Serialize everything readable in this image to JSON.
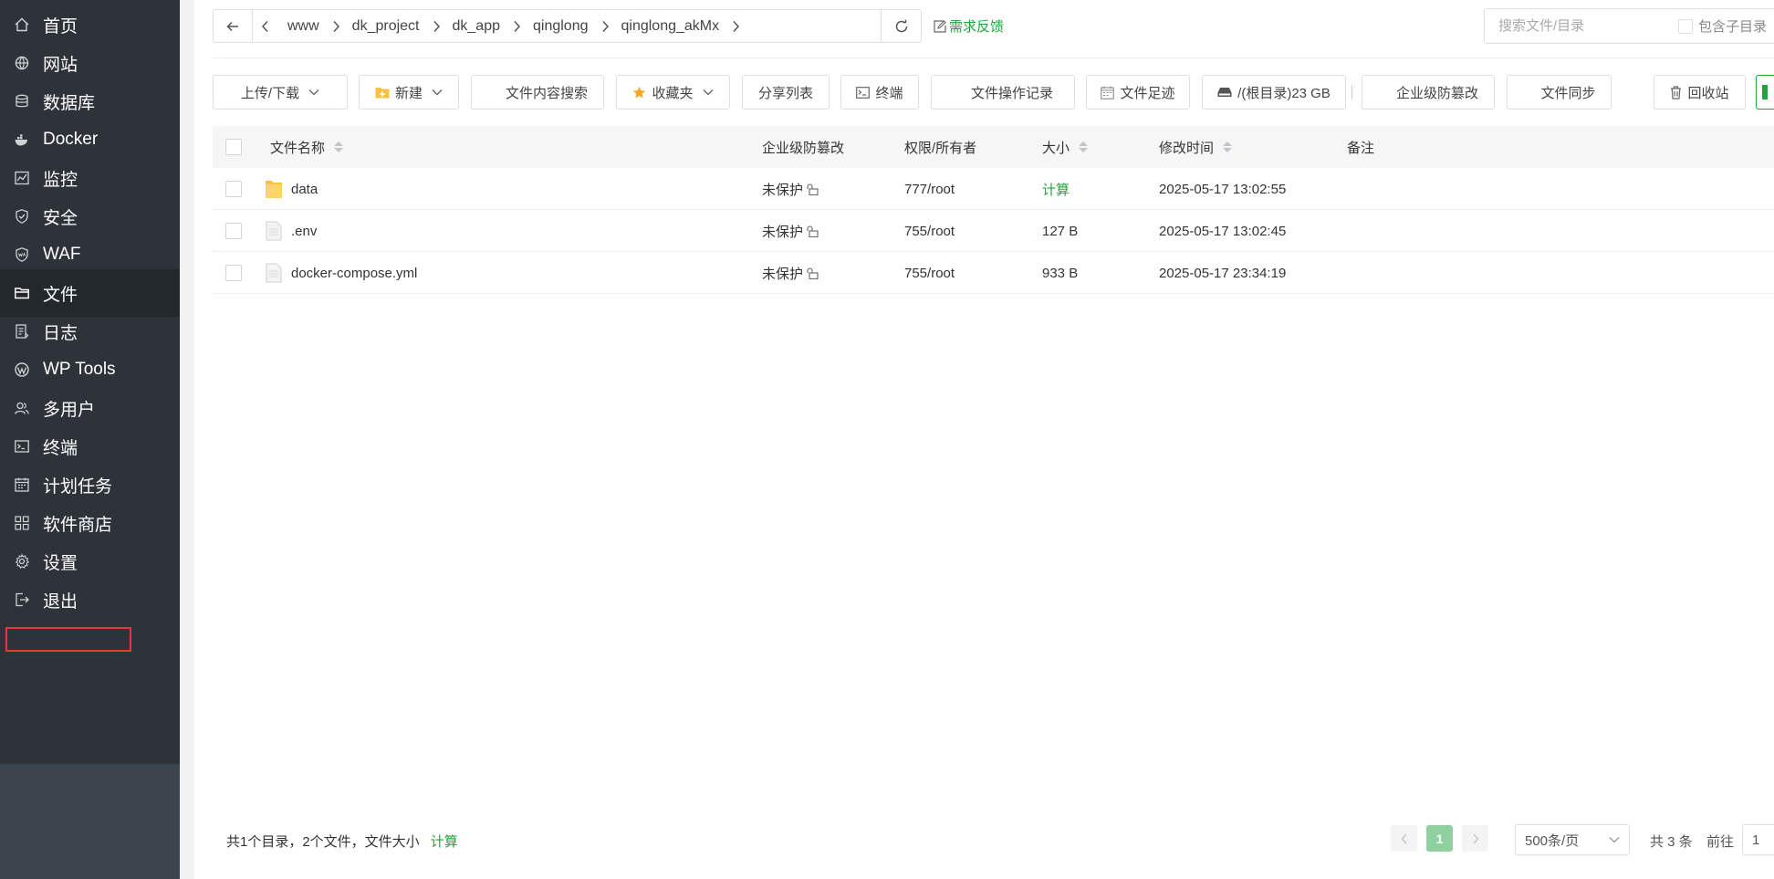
{
  "sidebar": {
    "items": [
      {
        "label": "首页",
        "icon": "home-icon"
      },
      {
        "label": "网站",
        "icon": "globe-icon"
      },
      {
        "label": "数据库",
        "icon": "database-icon"
      },
      {
        "label": "Docker",
        "icon": "docker-icon"
      },
      {
        "label": "监控",
        "icon": "monitor-icon"
      },
      {
        "label": "安全",
        "icon": "shield-icon"
      },
      {
        "label": "WAF",
        "icon": "waf-shield-icon"
      },
      {
        "label": "文件",
        "icon": "folder-icon",
        "active": true
      },
      {
        "label": "日志",
        "icon": "log-icon"
      },
      {
        "label": "WP Tools",
        "icon": "wordpress-icon"
      },
      {
        "label": "多用户",
        "icon": "users-icon"
      },
      {
        "label": "终端",
        "icon": "terminal-icon"
      },
      {
        "label": "计划任务",
        "icon": "calendar-icon"
      },
      {
        "label": "软件商店",
        "icon": "app-store-icon",
        "highlighted": true
      },
      {
        "label": "设置",
        "icon": "gear-icon"
      },
      {
        "label": "退出",
        "icon": "logout-icon"
      }
    ]
  },
  "path": {
    "segments": [
      "www",
      "dk_project",
      "dk_app",
      "qinglong",
      "qinglong_akMx"
    ]
  },
  "feedback_label": "需求反馈",
  "search": {
    "placeholder": "搜索文件/目录"
  },
  "include_subdir_label": "包含子目录",
  "toolbar": {
    "upload_download": "上传/下载",
    "new": "新建",
    "content_search": "文件内容搜索",
    "favorites": "收藏夹",
    "share_list": "分享列表",
    "terminal": "终端",
    "op_log": "文件操作记录",
    "footprint": "文件足迹",
    "disk": "/(根目录)23 GB",
    "tamper": "企业级防篡改",
    "sync": "文件同步",
    "recycle": "回收站"
  },
  "table": {
    "headers": {
      "name": "文件名称",
      "protect": "企业级防篡改",
      "perm": "权限/所有者",
      "size": "大小",
      "mtime": "修改时间",
      "note": "备注"
    },
    "rows": [
      {
        "name": "data",
        "type": "folder",
        "protect": "未保护",
        "perm": "777/root",
        "size": "计算",
        "mtime": "2025-05-17 13:02:55"
      },
      {
        "name": ".env",
        "type": "file",
        "protect": "未保护",
        "perm": "755/root",
        "size": "127 B",
        "mtime": "2025-05-17 13:02:45"
      },
      {
        "name": "docker-compose.yml",
        "type": "file",
        "protect": "未保护",
        "perm": "755/root",
        "size": "933 B",
        "mtime": "2025-05-17 23:34:19"
      }
    ]
  },
  "footer": {
    "summary": "共1个目录，2个文件，文件大小",
    "calc": "计算",
    "page": "1",
    "page_size": "500条/页",
    "total": "共 3 条",
    "goto_label": "前往",
    "goto_value": "1"
  },
  "colors": {
    "accent": "#20a53a",
    "sidebar": "#2d3339",
    "highlight_box": "#e53935"
  }
}
